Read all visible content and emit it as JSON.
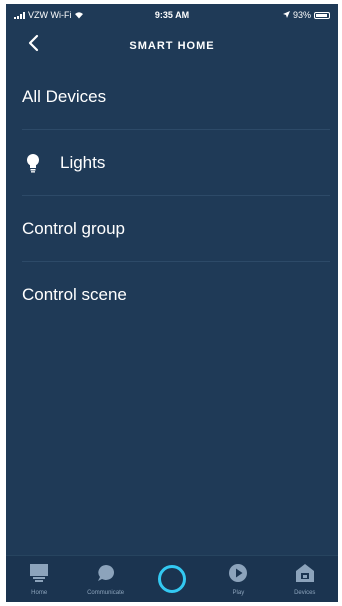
{
  "status_bar": {
    "carrier": "VZW Wi-Fi",
    "time": "9:35 AM",
    "battery": "93%"
  },
  "header": {
    "title": "SMART HOME",
    "back_icon": "chevron-left-icon"
  },
  "menu": {
    "items": [
      {
        "label": "All Devices",
        "icon": ""
      },
      {
        "label": "Lights",
        "icon": "lightbulb-icon"
      },
      {
        "label": "Control group",
        "icon": ""
      },
      {
        "label": "Control scene",
        "icon": ""
      }
    ]
  },
  "bottom_nav": {
    "items": [
      {
        "label": "Home",
        "icon": "home-icon"
      },
      {
        "label": "Communicate",
        "icon": "chat-icon"
      },
      {
        "label": "",
        "icon": "alexa-icon"
      },
      {
        "label": "Play",
        "icon": "play-icon"
      },
      {
        "label": "Devices",
        "icon": "devices-icon"
      }
    ]
  },
  "colors": {
    "background": "#1f3a57",
    "nav_background": "#1b3450",
    "alexa_accent": "#33c9f2",
    "divider": "#2d4a68",
    "inactive_icon": "#8ca3bb"
  }
}
